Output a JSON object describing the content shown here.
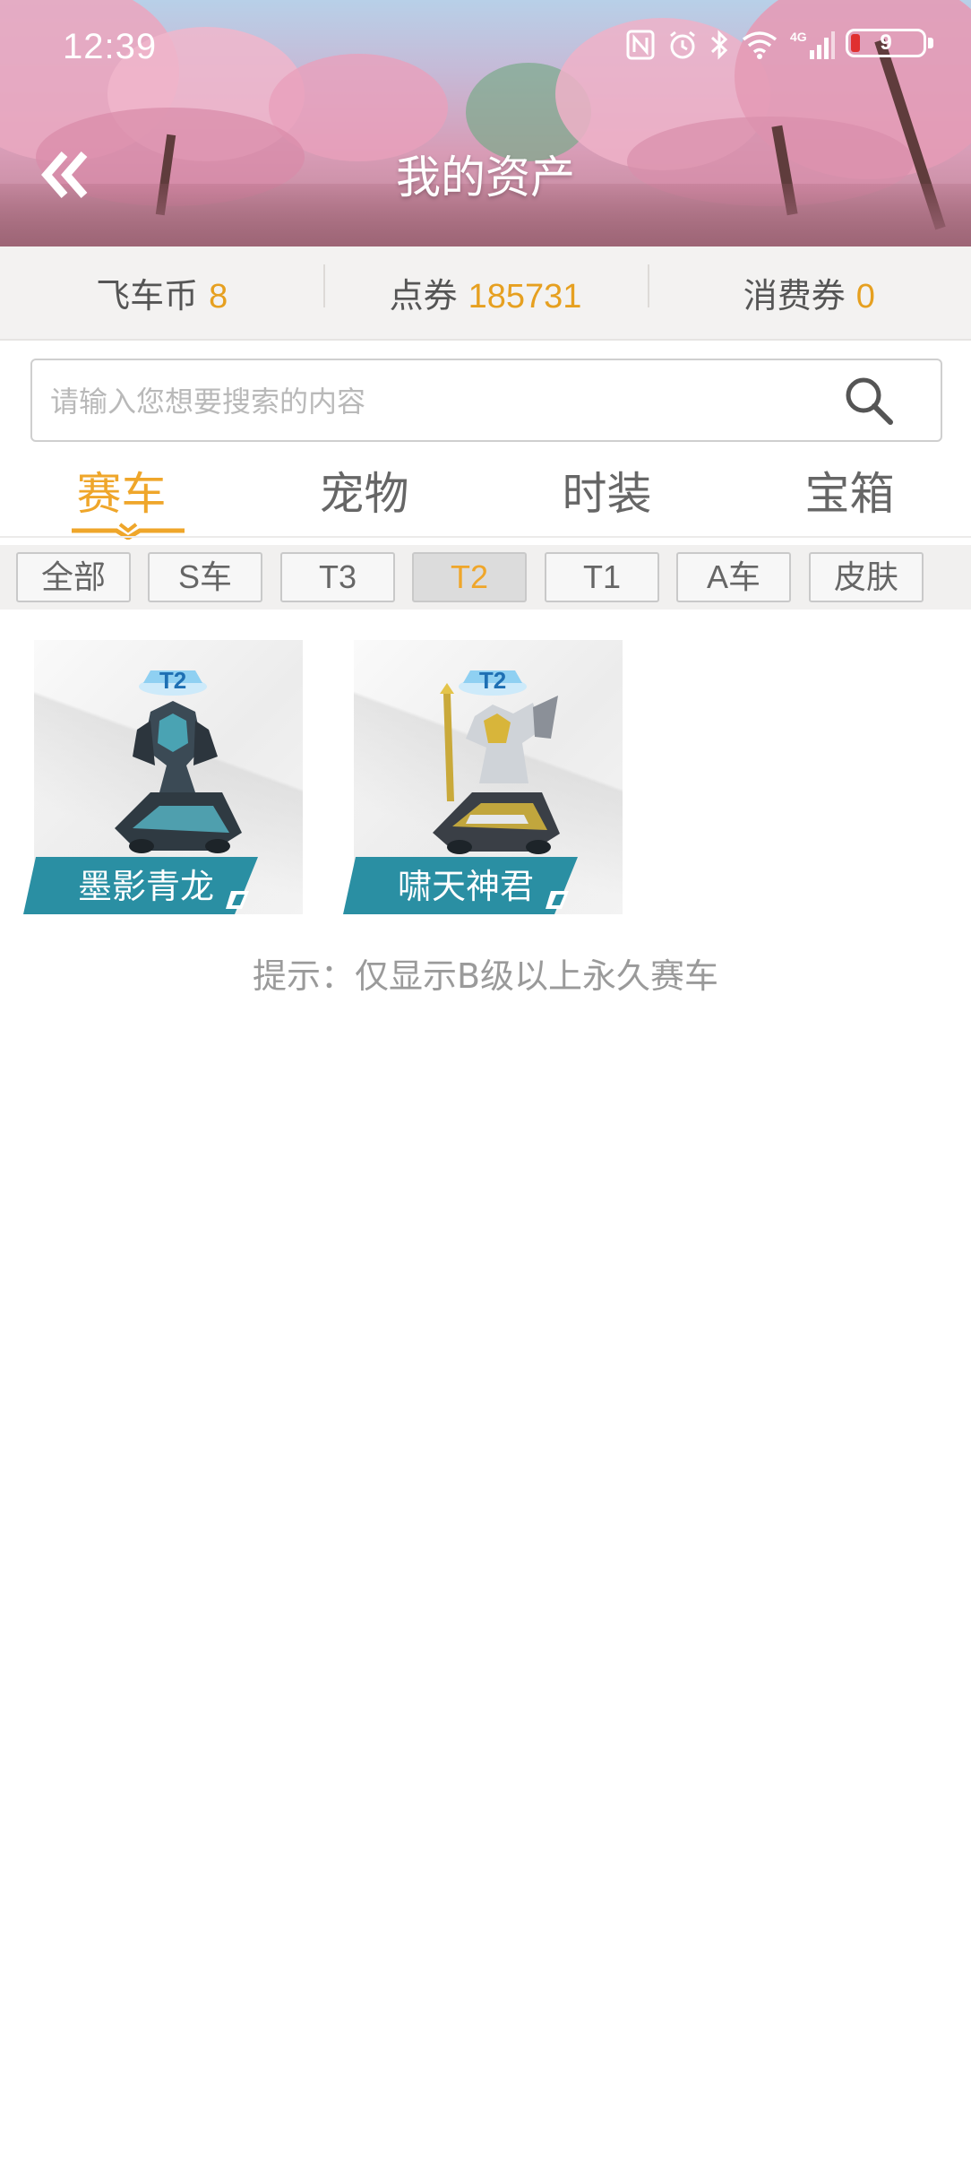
{
  "status_bar": {
    "time": "12:39",
    "battery_level": "9",
    "network": "4G",
    "icons": [
      "nfc-icon",
      "alarm-icon",
      "bluetooth-icon",
      "wifi-icon",
      "signal-icon",
      "battery-icon"
    ]
  },
  "header": {
    "title": "我的资产",
    "back_icon": "double-chevron-left-icon"
  },
  "balances": [
    {
      "label": "飞车币",
      "value": "8"
    },
    {
      "label": "点券",
      "value": "185731"
    },
    {
      "label": "消费券",
      "value": "0"
    }
  ],
  "search": {
    "placeholder": "请输入您想要搜索的内容",
    "value": "",
    "icon": "search-icon"
  },
  "tabs": [
    {
      "label": "赛车",
      "active": true
    },
    {
      "label": "宠物",
      "active": false
    },
    {
      "label": "时装",
      "active": false
    },
    {
      "label": "宝箱",
      "active": false
    }
  ],
  "filters": [
    {
      "label": "全部",
      "active": false
    },
    {
      "label": "S车",
      "active": false
    },
    {
      "label": "T3",
      "active": false
    },
    {
      "label": "T2",
      "active": true
    },
    {
      "label": "T1",
      "active": false
    },
    {
      "label": "A车",
      "active": false
    },
    {
      "label": "皮肤",
      "active": false
    }
  ],
  "cars": [
    {
      "name": "墨影青龙",
      "tier_badge": "T2"
    },
    {
      "name": "啸天神君",
      "tier_badge": "T2"
    }
  ],
  "hint": "提示：仅显示B级以上永久赛车",
  "colors": {
    "accent": "#efa62a",
    "label_teal": "#2a8fa3",
    "text_gray": "#666666"
  }
}
